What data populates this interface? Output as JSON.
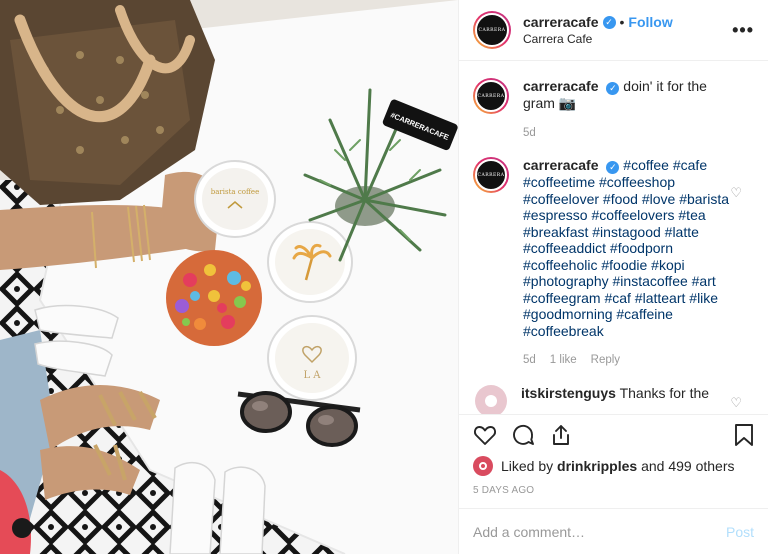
{
  "header": {
    "avatar_text": "CARRERA",
    "username": "carreracafe",
    "verified_mark": "✓",
    "separator": "•",
    "follow_label": "Follow",
    "location": "Carrera Cafe",
    "more_label": "•••"
  },
  "comments": [
    {
      "username": "carreracafe",
      "text": "doin' it for the gram 📷",
      "time": "5d"
    },
    {
      "username": "carreracafe",
      "text": "#coffee #cafe #coffeetime #coffeeshop #coffeelover #food #love #barista #espresso #coffeelovers #tea #breakfast #instagood #latte #coffeeaddict #foodporn #coffeeholic #foodie #kopi #photography #instacoffee #art #coffeegram #caf #latteart #like #goodmorning #caffeine #coffeebreak",
      "time": "5d",
      "likes": "1 like",
      "reply": "Reply"
    },
    {
      "username": "itskirstenguys",
      "text": "Thanks for the"
    }
  ],
  "likes": {
    "prefix": "Liked by",
    "user": "drinkripples",
    "suffix": "and 499 others"
  },
  "posted": "5 DAYS AGO",
  "add_comment": {
    "placeholder": "Add a comment…",
    "post_label": "Post"
  },
  "photo": {
    "sign_text": "#CARRERACAFE",
    "cup1_text": "barista coffee",
    "cup3_text": "L A"
  },
  "colors": {
    "link_blue": "#3897f0",
    "hashtag": "#003569",
    "muted": "#999999"
  }
}
